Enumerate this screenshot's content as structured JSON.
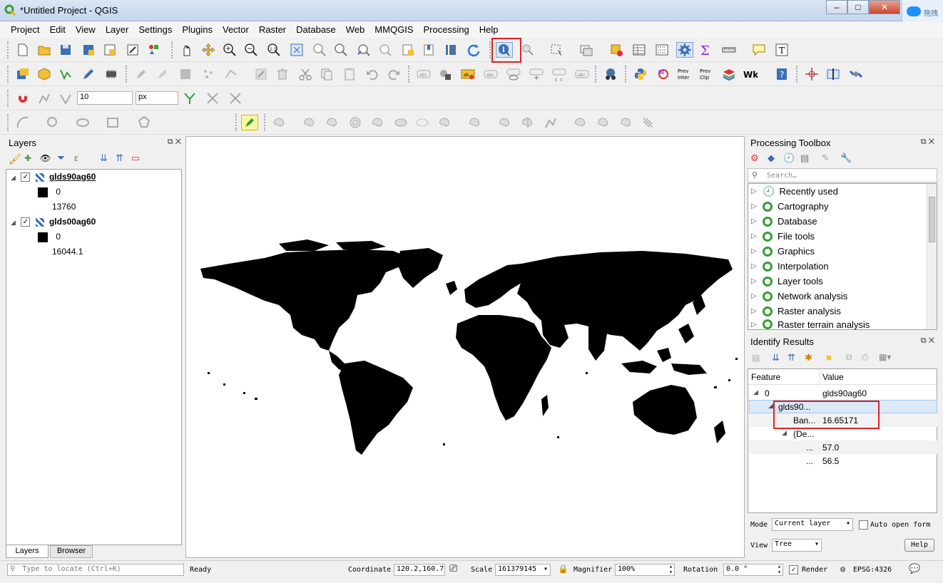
{
  "window": {
    "title": "*Untitled Project - QGIS",
    "min": "–",
    "max": "□",
    "close": "✕",
    "ext_text": "拖拽"
  },
  "menu": [
    "Project",
    "Edit",
    "View",
    "Layer",
    "Settings",
    "Plugins",
    "Vector",
    "Raster",
    "Database",
    "Web",
    "MMQGIS",
    "Processing",
    "Help"
  ],
  "toolbar": {
    "size_value": "10",
    "size_unit": "px"
  },
  "layers_panel": {
    "title": "Layers",
    "layers": [
      {
        "name": "glds90ag60",
        "min": "0",
        "max": "13760"
      },
      {
        "name": "glds00ag60",
        "min": "0",
        "max": "16044.1"
      }
    ],
    "tabs": [
      "Layers",
      "Browser"
    ]
  },
  "processing": {
    "title": "Processing Toolbox",
    "search_placeholder": "Search…",
    "items": [
      "Recently used",
      "Cartography",
      "Database",
      "File tools",
      "Graphics",
      "Interpolation",
      "Layer tools",
      "Network analysis",
      "Raster analysis",
      "Raster terrain analysis"
    ]
  },
  "identify": {
    "title": "Identify Results",
    "col_feature": "Feature",
    "col_value": "Value",
    "rows": [
      {
        "feature": "0",
        "value": "glds90ag60"
      },
      {
        "feature": "glds90...",
        "value": ""
      },
      {
        "feature": "Ban...",
        "value": "16.65171"
      },
      {
        "feature": "(De...",
        "value": ""
      },
      {
        "feature": "...",
        "value": "57.0"
      },
      {
        "feature": "...",
        "value": "56.5"
      }
    ],
    "mode_label": "Mode",
    "mode_value": "Current layer",
    "auto_open": "Auto open form",
    "view_label": "View",
    "view_value": "Tree",
    "help": "Help"
  },
  "status": {
    "locate_placeholder": "Type to locate (Ctrl+K)",
    "ready": "Ready",
    "coordinate_label": "Coordinate",
    "coordinate": "120.2,160.7",
    "scale_label": "Scale",
    "scale": "161379145",
    "magnifier_label": "Magnifier",
    "magnifier": "100%",
    "rotation_label": "Rotation",
    "rotation": "0.0 °",
    "render": "Render",
    "crs": "EPSG:4326"
  }
}
